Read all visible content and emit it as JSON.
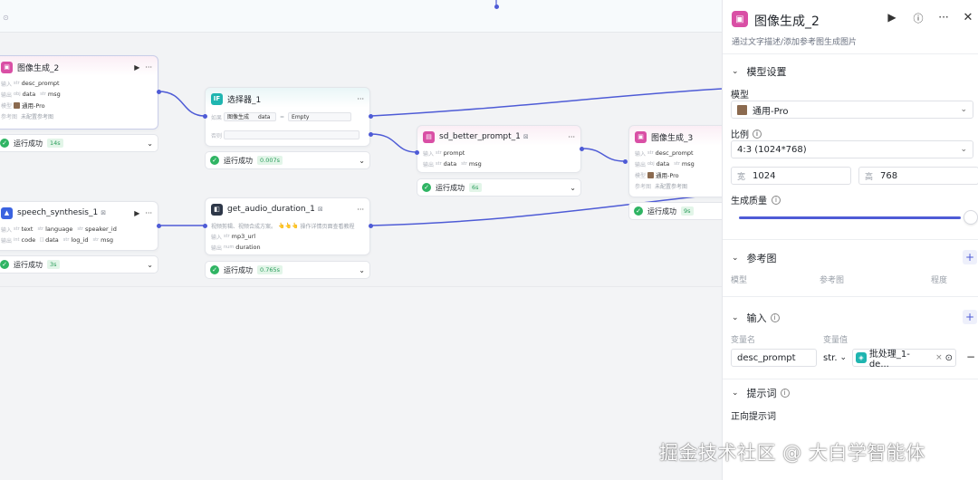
{
  "canvas": {
    "nodes": {
      "img2": {
        "title": "图像生成_2",
        "r1_label": "输入",
        "r1_chip": "desc_prompt",
        "r2_label": "输出",
        "r2_a": "data",
        "r2_b": "msg",
        "r3_label": "模型",
        "r3_val": "通用-Pro",
        "r4_label": "参考图",
        "r4_val": "未配置参考图",
        "status": "运行成功",
        "time": "14s"
      },
      "sel1": {
        "title": "选择器_1",
        "if_label": "如果",
        "if_field": "图像生成",
        "if_var": "data",
        "op": "=",
        "val": "Empty",
        "else_label": "否则",
        "status": "运行成功",
        "time": "0.007s"
      },
      "sd": {
        "title": "sd_better_prompt_1",
        "r1_label": "输入",
        "r1_chip": "prompt",
        "r2_label": "输出",
        "r2_a": "data",
        "r2_b": "msg",
        "status": "运行成功",
        "time": "6s"
      },
      "img3": {
        "title": "图像生成_3",
        "r1_label": "输入",
        "r1_chip": "desc_prompt",
        "r2_label": "输出",
        "r2_a": "data",
        "r2_b": "msg",
        "r3_label": "模型",
        "r3_val": "通用-Pro",
        "r4_label": "参考图",
        "r4_val": "未配置参考图",
        "status": "运行成功",
        "time": "9s"
      },
      "speech": {
        "title": "speech_synthesis_1",
        "r1_label": "输入",
        "r1_a": "text",
        "r1_b": "language",
        "r1_c": "speaker_id",
        "r2_label": "输出",
        "r2_a": "code",
        "r2_b": "data",
        "r2_c": "log_id",
        "r2_d": "msg",
        "status": "运行成功",
        "time": "3s"
      },
      "audio": {
        "title": "get_audio_duration_1",
        "desc": "视频剪辑、视频合成方案。",
        "desc2": "操作详情页面查看教程",
        "r1_label": "输入",
        "r1_chip": "mp3_url",
        "r2_label": "输出",
        "r2_chip": "duration",
        "status": "运行成功",
        "time": "0.765s"
      }
    }
  },
  "panel": {
    "title": "图像生成_2",
    "subtitle": "通过文字描述/添加参考图生成图片",
    "model_settings": "模型设置",
    "model_label": "模型",
    "model_value": "通用-Pro",
    "ratio_label": "比例",
    "ratio_value": "4:3 (1024*768)",
    "width_prefix": "宽",
    "width_value": "1024",
    "height_prefix": "高",
    "height_value": "768",
    "quality_label": "生成质量",
    "quality_level": 0.95,
    "ref_section": "参考图",
    "ref_cols": [
      "模型",
      "参考图",
      "程度"
    ],
    "input_section": "输入",
    "var_name_header": "变量名",
    "var_value_header": "变量值",
    "var_name": "desc_prompt",
    "var_type": "str.",
    "var_ref": "批处理_1- de...",
    "prompt_section": "提示词",
    "positive_prompt": "正向提示词"
  },
  "watermark": "掘金技术社区 @ 大白学智能体",
  "colors": {
    "accent": "#4e5bd6",
    "success": "#2fb463",
    "node_pink": "#d94fa5",
    "node_teal": "#1fb5b0"
  }
}
